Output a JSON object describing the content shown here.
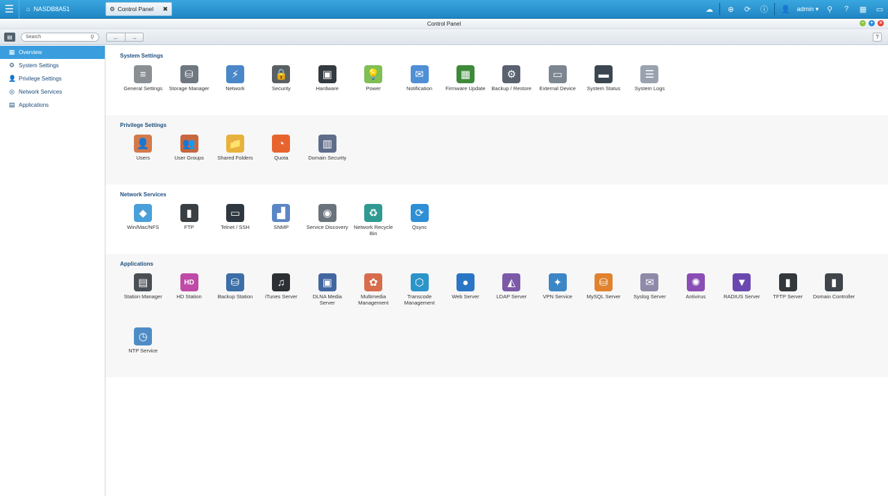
{
  "topbar": {
    "home_tab_label": "NASDB8A51",
    "active_tab_label": "Control Panel",
    "user_name": "admin",
    "icons": [
      "cloud-icon",
      "download-icon",
      "sync-icon",
      "info-icon",
      "user-icon",
      "search-icon",
      "help-icon",
      "grid-icon",
      "monitor-icon"
    ]
  },
  "window": {
    "title": "Control Panel"
  },
  "toolbar": {
    "search_placeholder": "Search",
    "back_label": "←",
    "forward_label": "→",
    "help_label": "?"
  },
  "sidebar": {
    "items": [
      {
        "label": "Overview",
        "icon": "overview-icon",
        "glyph": "▦",
        "active": true
      },
      {
        "label": "System Settings",
        "icon": "gear-icon",
        "glyph": "⚙",
        "active": false
      },
      {
        "label": "Privilege Settings",
        "icon": "user-icon",
        "glyph": "👤",
        "active": false
      },
      {
        "label": "Network Services",
        "icon": "globe-icon",
        "glyph": "◎",
        "active": false
      },
      {
        "label": "Applications",
        "icon": "applications-icon",
        "glyph": "▤",
        "active": false
      }
    ]
  },
  "sections": [
    {
      "title": "System Settings",
      "items": [
        {
          "label": "General Settings",
          "icon": "general-settings-icon",
          "glyph": "≡",
          "color": "#8a8f94"
        },
        {
          "label": "Storage Manager",
          "icon": "storage-manager-icon",
          "glyph": "⛁",
          "color": "#6f7780"
        },
        {
          "label": "Network",
          "icon": "network-icon",
          "glyph": "⚡",
          "color": "#4a87c8"
        },
        {
          "label": "Security",
          "icon": "security-icon",
          "glyph": "🔒",
          "color": "#5a5f64"
        },
        {
          "label": "Hardware",
          "icon": "hardware-icon",
          "glyph": "▣",
          "color": "#333a40"
        },
        {
          "label": "Power",
          "icon": "power-icon",
          "glyph": "💡",
          "color": "#7fbf55"
        },
        {
          "label": "Notification",
          "icon": "notification-icon",
          "glyph": "✉",
          "color": "#4e8fd6"
        },
        {
          "label": "Firmware Update",
          "icon": "firmware-update-icon",
          "glyph": "▦",
          "color": "#3f8a3a"
        },
        {
          "label": "Backup / Restore",
          "icon": "backup-restore-icon",
          "glyph": "⚙",
          "color": "#5a6270"
        },
        {
          "label": "External Device",
          "icon": "external-device-icon",
          "glyph": "▭",
          "color": "#7c8690"
        },
        {
          "label": "System Status",
          "icon": "system-status-icon",
          "glyph": "▬",
          "color": "#3c4650"
        },
        {
          "label": "System Logs",
          "icon": "system-logs-icon",
          "glyph": "☰",
          "color": "#9aa2b0"
        }
      ]
    },
    {
      "title": "Privilege Settings",
      "items": [
        {
          "label": "Users",
          "icon": "users-icon",
          "glyph": "👤",
          "color": "#d27a4b"
        },
        {
          "label": "User Groups",
          "icon": "user-groups-icon",
          "glyph": "👥",
          "color": "#c6673f"
        },
        {
          "label": "Shared Folders",
          "icon": "shared-folders-icon",
          "glyph": "📁",
          "color": "#e7b23c"
        },
        {
          "label": "Quota",
          "icon": "quota-icon",
          "glyph": "◔",
          "color": "#e8642e"
        },
        {
          "label": "Domain Security",
          "icon": "domain-security-icon",
          "glyph": "▥",
          "color": "#5f6d8a"
        }
      ]
    },
    {
      "title": "Network Services",
      "items": [
        {
          "label": "Win/Mac/NFS",
          "icon": "win-mac-nfs-icon",
          "glyph": "◆",
          "color": "#4aa0d8"
        },
        {
          "label": "FTP",
          "icon": "ftp-icon",
          "glyph": "▮",
          "color": "#3a3f44"
        },
        {
          "label": "Telnet / SSH",
          "icon": "telnet-ssh-icon",
          "glyph": "▭",
          "color": "#2f3840"
        },
        {
          "label": "SNMP",
          "icon": "snmp-icon",
          "glyph": "▟",
          "color": "#5b86c6"
        },
        {
          "label": "Service Discovery",
          "icon": "service-discovery-icon",
          "glyph": "◉",
          "color": "#6a737c"
        },
        {
          "label": "Network Recycle Bin",
          "icon": "network-recycle-bin-icon",
          "glyph": "♻",
          "color": "#2f9a92"
        },
        {
          "label": "Qsync",
          "icon": "qsync-icon",
          "glyph": "⟳",
          "color": "#2e8fd6"
        }
      ]
    },
    {
      "title": "Applications",
      "items": [
        {
          "label": "Station Manager",
          "icon": "station-manager-icon",
          "glyph": "▤",
          "color": "#4a4f55"
        },
        {
          "label": "HD Station",
          "icon": "hd-station-icon",
          "glyph": "HD",
          "color": "#c04aa8"
        },
        {
          "label": "Backup Station",
          "icon": "backup-station-icon",
          "glyph": "⛁",
          "color": "#3c6ea8"
        },
        {
          "label": "iTunes Server",
          "icon": "itunes-server-icon",
          "glyph": "♫",
          "color": "#2c3034"
        },
        {
          "label": "DLNA Media Server",
          "icon": "dlna-media-server-icon",
          "glyph": "▣",
          "color": "#4266a0"
        },
        {
          "label": "Multimedia Management",
          "icon": "multimedia-management-icon",
          "glyph": "✿",
          "color": "#d86d4d"
        },
        {
          "label": "Transcode Management",
          "icon": "transcode-management-icon",
          "glyph": "⬡",
          "color": "#2b94c9"
        },
        {
          "label": "Web Server",
          "icon": "web-server-icon",
          "glyph": "●",
          "color": "#2a76c4"
        },
        {
          "label": "LDAP Server",
          "icon": "ldap-server-icon",
          "glyph": "◭",
          "color": "#7b5aa8"
        },
        {
          "label": "VPN Service",
          "icon": "vpn-service-icon",
          "glyph": "✦",
          "color": "#3d86c6"
        },
        {
          "label": "MySQL Server",
          "icon": "mysql-server-icon",
          "glyph": "⛁",
          "color": "#e0822e"
        },
        {
          "label": "Syslog Server",
          "icon": "syslog-server-icon",
          "glyph": "✉",
          "color": "#8e8aa8"
        },
        {
          "label": "Antivirus",
          "icon": "antivirus-icon",
          "glyph": "✺",
          "color": "#8a4db5"
        },
        {
          "label": "RADIUS Server",
          "icon": "radius-server-icon",
          "glyph": "▼",
          "color": "#6b48b0"
        },
        {
          "label": "TFTP Server",
          "icon": "tftp-server-icon",
          "glyph": "▮",
          "color": "#33383d"
        },
        {
          "label": "Domain Controller",
          "icon": "domain-controller-icon",
          "glyph": "▮",
          "color": "#3f454b"
        },
        {
          "label": "NTP Service",
          "icon": "ntp-service-icon",
          "glyph": "◷",
          "color": "#4f8cc7"
        }
      ]
    }
  ]
}
